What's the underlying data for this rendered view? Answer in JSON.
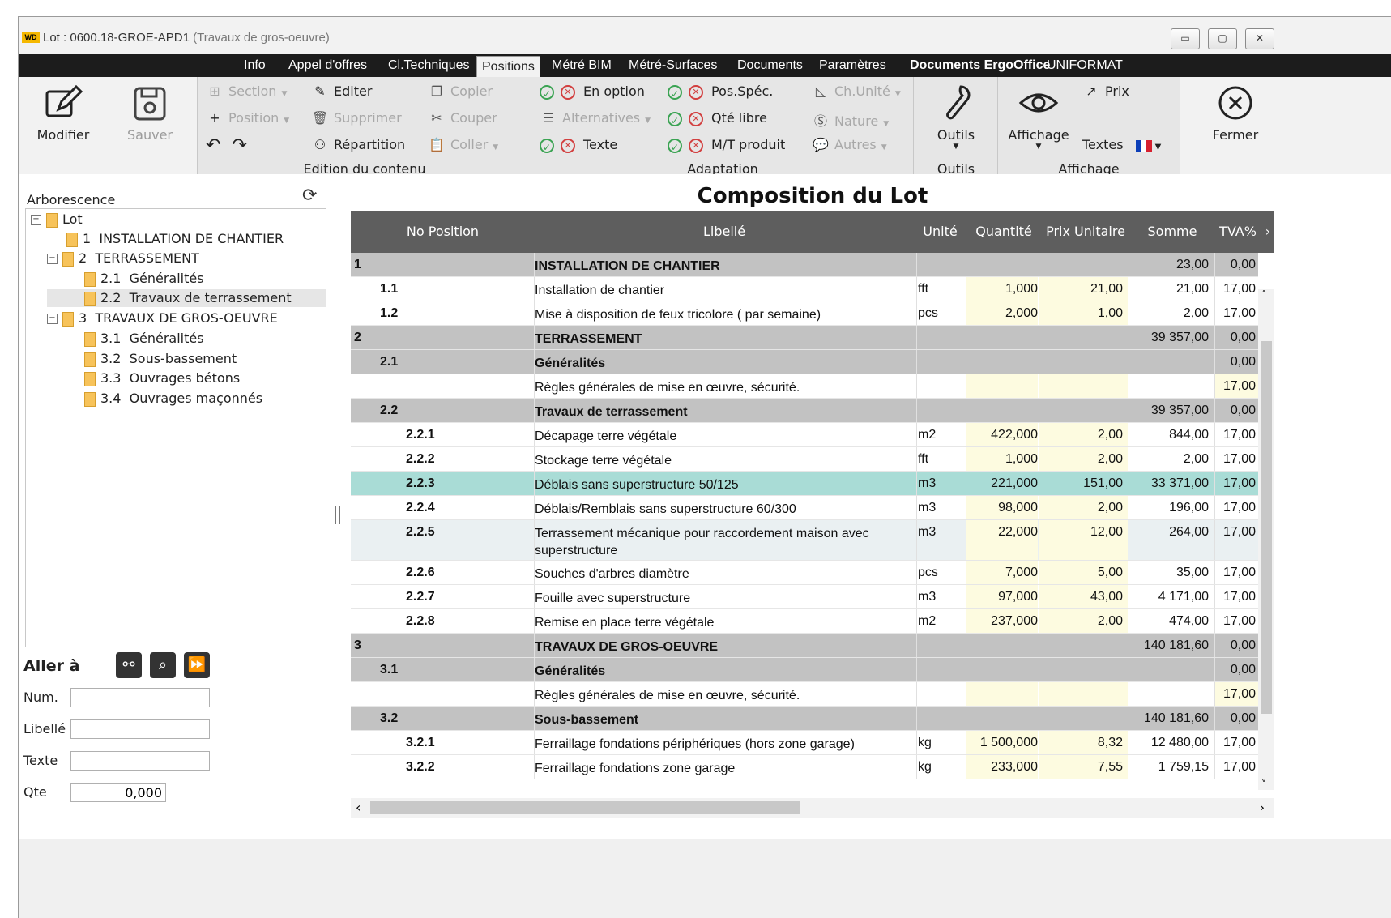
{
  "window": {
    "logo": "WD",
    "title": "Lot : 0600.18-GROE-APD1",
    "subtitle": "(Travaux de gros-oeuvre)",
    "controls": [
      "▭",
      "▢",
      "✕"
    ]
  },
  "menu": [
    {
      "label": "Info",
      "active": false
    },
    {
      "label": "Appel d'offres",
      "active": false
    },
    {
      "label": "Cl.Techniques",
      "active": false
    },
    {
      "label": "Positions",
      "active": true
    },
    {
      "label": "Métré BIM",
      "active": false
    },
    {
      "label": "Métré-Surfaces",
      "active": false
    },
    {
      "label": "Documents",
      "active": false
    },
    {
      "label": "Paramètres",
      "active": false
    },
    {
      "label": "Documents ErgoOffice",
      "active": false
    },
    {
      "label": "UNIFORMAT",
      "active": false
    }
  ],
  "ribbon": {
    "modifier": "Modifier",
    "sauver": "Sauver",
    "edition": {
      "section": "Section",
      "position": "Position",
      "editer": "Editer",
      "supprimer": "Supprimer",
      "repartition": "Répartition",
      "copier": "Copier",
      "couper": "Couper",
      "coller": "Coller",
      "caption": "Edition du contenu"
    },
    "adaptation": {
      "en_option": "En option",
      "alternatives": "Alternatives",
      "texte": "Texte",
      "pos_spec": "Pos.Spéc.",
      "qte_libre": "Qté libre",
      "mt_produit": "M/T produit",
      "ch_unite": "Ch.Unité",
      "nature": "Nature",
      "autres": "Autres",
      "caption": "Adaptation"
    },
    "outils": {
      "label": "Outils",
      "caption": "Outils"
    },
    "affichage": {
      "label": "Affichage",
      "prix": "Prix",
      "textes": "Textes",
      "caption": "Affichage"
    },
    "fermer": "Fermer"
  },
  "tree": {
    "title": "Arborescence",
    "nodes": [
      {
        "num": "",
        "label": "Lot"
      },
      {
        "num": "1",
        "label": "INSTALLATION DE CHANTIER"
      },
      {
        "num": "2",
        "label": "TERRASSEMENT"
      },
      {
        "num": "2.1",
        "label": "Généralités"
      },
      {
        "num": "2.2",
        "label": "Travaux de terrassement"
      },
      {
        "num": "3",
        "label": "TRAVAUX DE GROS-OEUVRE"
      },
      {
        "num": "3.1",
        "label": "Généralités"
      },
      {
        "num": "3.2",
        "label": "Sous-bassement"
      },
      {
        "num": "3.3",
        "label": "Ouvrages bétons"
      },
      {
        "num": "3.4",
        "label": "Ouvrages maçonnés"
      }
    ]
  },
  "goto": {
    "title": "Aller à",
    "num_label": "Num.",
    "libelle_label": "Libellé",
    "texte_label": "Texte",
    "qte_label": "Qte",
    "qte_value": "0,000"
  },
  "grid": {
    "title": "Composition du Lot",
    "headers": {
      "no": "No Position",
      "libelle": "Libellé",
      "unite": "Unité",
      "quantite": "Quantité",
      "prix": "Prix Unitaire",
      "somme": "Somme",
      "tva": "TVA%"
    },
    "rows": [
      {
        "no": "1",
        "lvl": 0,
        "type": "grp",
        "lib": "INSTALLATION DE CHANTIER",
        "unit": "",
        "qty": "",
        "prix": "",
        "somme": "23,00",
        "tva": "0,00"
      },
      {
        "no": "1.1",
        "lvl": 1,
        "type": "pos",
        "lib": "Installation de chantier",
        "unit": "fft",
        "qty": "1,000",
        "prix": "21,00",
        "somme": "21,00",
        "tva": "17,00"
      },
      {
        "no": "1.2",
        "lvl": 1,
        "type": "pos",
        "lib": "Mise à disposition de feux tricolore ( par semaine)",
        "unit": "pcs",
        "qty": "2,000",
        "prix": "1,00",
        "somme": "2,00",
        "tva": "17,00"
      },
      {
        "no": "2",
        "lvl": 0,
        "type": "grp",
        "lib": "TERRASSEMENT",
        "unit": "",
        "qty": "",
        "prix": "",
        "somme": "39 357,00",
        "tva": "0,00"
      },
      {
        "no": "2.1",
        "lvl": 1,
        "type": "grp",
        "lib": "Généralités",
        "unit": "",
        "qty": "",
        "prix": "",
        "somme": "",
        "tva": "0,00"
      },
      {
        "no": "",
        "lvl": 1,
        "type": "txt",
        "lib": "Règles générales de mise en œuvre, sécurité.",
        "unit": "",
        "qty": "",
        "prix": "",
        "somme": "",
        "tva": "17,00"
      },
      {
        "no": "2.2",
        "lvl": 1,
        "type": "grp",
        "lib": "Travaux de terrassement",
        "unit": "",
        "qty": "",
        "prix": "",
        "somme": "39 357,00",
        "tva": "0,00"
      },
      {
        "no": "2.2.1",
        "lvl": 2,
        "type": "pos",
        "lib": "Décapage terre végétale",
        "unit": "m2",
        "qty": "422,000",
        "prix": "2,00",
        "somme": "844,00",
        "tva": "17,00"
      },
      {
        "no": "2.2.2",
        "lvl": 2,
        "type": "pos",
        "lib": "Stockage terre végétale",
        "unit": "fft",
        "qty": "1,000",
        "prix": "2,00",
        "somme": "2,00",
        "tva": "17,00"
      },
      {
        "no": "2.2.3",
        "lvl": 2,
        "type": "hl",
        "lib": "Déblais sans superstructure 50/125",
        "unit": "m3",
        "qty": "221,000",
        "prix": "151,00",
        "somme": "33 371,00",
        "tva": "17,00"
      },
      {
        "no": "2.2.4",
        "lvl": 2,
        "type": "pos",
        "lib": "Déblais/Remblais sans superstructure 60/300",
        "unit": "m3",
        "qty": "98,000",
        "prix": "2,00",
        "somme": "196,00",
        "tva": "17,00"
      },
      {
        "no": "2.2.5",
        "lvl": 2,
        "type": "alt",
        "lib": "Terrassement mécanique pour raccordement maison avec superstructure",
        "unit": "m3",
        "qty": "22,000",
        "prix": "12,00",
        "somme": "264,00",
        "tva": "17,00"
      },
      {
        "no": "2.2.6",
        "lvl": 2,
        "type": "pos",
        "lib": "Souches d'arbres diamètre",
        "unit": "pcs",
        "qty": "7,000",
        "prix": "5,00",
        "somme": "35,00",
        "tva": "17,00"
      },
      {
        "no": "2.2.7",
        "lvl": 2,
        "type": "pos",
        "lib": "Fouille avec superstructure",
        "unit": "m3",
        "qty": "97,000",
        "prix": "43,00",
        "somme": "4 171,00",
        "tva": "17,00"
      },
      {
        "no": "2.2.8",
        "lvl": 2,
        "type": "pos",
        "lib": "Remise en place terre végétale",
        "unit": "m2",
        "qty": "237,000",
        "prix": "2,00",
        "somme": "474,00",
        "tva": "17,00"
      },
      {
        "no": "3",
        "lvl": 0,
        "type": "grp",
        "lib": "TRAVAUX DE GROS-OEUVRE",
        "unit": "",
        "qty": "",
        "prix": "",
        "somme": "140 181,60",
        "tva": "0,00"
      },
      {
        "no": "3.1",
        "lvl": 1,
        "type": "grp",
        "lib": "Généralités",
        "unit": "",
        "qty": "",
        "prix": "",
        "somme": "",
        "tva": "0,00"
      },
      {
        "no": "",
        "lvl": 1,
        "type": "txt",
        "lib": "Règles générales de mise en œuvre, sécurité.",
        "unit": "",
        "qty": "",
        "prix": "",
        "somme": "",
        "tva": "17,00"
      },
      {
        "no": "3.2",
        "lvl": 1,
        "type": "grp",
        "lib": "Sous-bassement",
        "unit": "",
        "qty": "",
        "prix": "",
        "somme": "140 181,60",
        "tva": "0,00"
      },
      {
        "no": "3.2.1",
        "lvl": 2,
        "type": "pos",
        "lib": "Ferraillage fondations périphériques (hors zone garage)",
        "unit": "kg",
        "qty": "1 500,000",
        "prix": "8,32",
        "somme": "12 480,00",
        "tva": "17,00"
      },
      {
        "no": "3.2.2",
        "lvl": 2,
        "type": "pos",
        "lib": "Ferraillage fondations zone garage",
        "unit": "kg",
        "qty": "233,000",
        "prix": "7,55",
        "somme": "1 759,15",
        "tva": "17,00"
      }
    ]
  },
  "colors": {
    "menubar": "#1c1c1c",
    "grid_header": "#5e5e5e",
    "group_row": "#c2c2c2",
    "highlight_row": "#a9dcd6",
    "input_cell": "#fdfbe0",
    "ok_green": "#3aa352",
    "cancel_red": "#d23f3f"
  }
}
